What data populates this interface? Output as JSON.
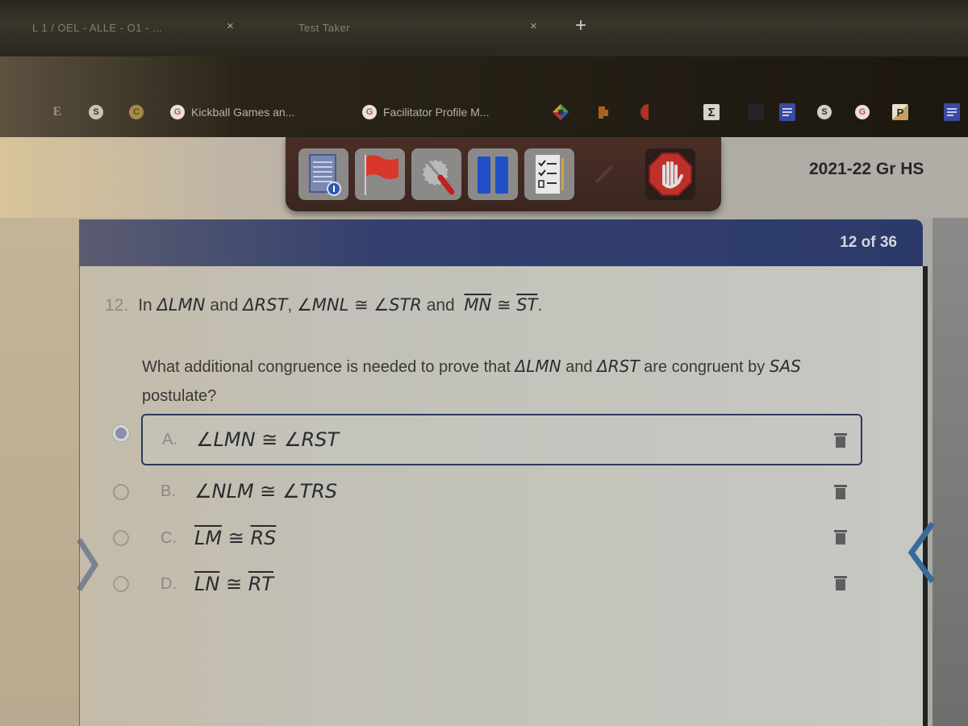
{
  "browser": {
    "tabs": [
      {
        "title": "L 1 / OEL - ALLE - O1 - ...",
        "close": "×"
      },
      {
        "title": "Test Taker",
        "close": "×"
      }
    ],
    "new_tab": "+"
  },
  "bookmarks": [
    {
      "icon": "extension-icon",
      "glyph": "E",
      "label": ""
    },
    {
      "icon": "circle-arrow-icon",
      "glyph": "S",
      "label": ""
    },
    {
      "icon": "c-circle-icon",
      "glyph": "C",
      "label": ""
    },
    {
      "icon": "google-icon",
      "glyph": "G",
      "label": "Kickball Games an..."
    },
    {
      "icon": "google-icon",
      "glyph": "G",
      "label": "Facilitator Profile M..."
    }
  ],
  "extensions": [
    {
      "icon": "color-diamond-icon"
    },
    {
      "icon": "puzzle-icon"
    },
    {
      "icon": "red-half-circle-icon"
    },
    {
      "icon": "sigma-icon",
      "glyph": "Σ"
    },
    {
      "icon": "blue-square-icon"
    },
    {
      "icon": "docs-icon"
    },
    {
      "icon": "circle-arrow-icon",
      "glyph": "S"
    },
    {
      "icon": "google-icon",
      "glyph": "G"
    },
    {
      "icon": "p-icon",
      "glyph": "P"
    },
    {
      "icon": "docs-icon"
    }
  ],
  "toolbar": {
    "buttons": [
      {
        "name": "test-info-button",
        "icon": "document-info-icon"
      },
      {
        "name": "flag-button",
        "icon": "flag-icon"
      },
      {
        "name": "tools-button",
        "icon": "gear-screwdriver-icon"
      },
      {
        "name": "pause-button",
        "icon": "pause-icon"
      },
      {
        "name": "review-button",
        "icon": "checklist-icon"
      },
      {
        "name": "disabled-button",
        "icon": "dim-icon"
      },
      {
        "name": "stop-button",
        "icon": "stop-hand-icon"
      }
    ]
  },
  "course_title": "2021-22 Gr HS",
  "progress": {
    "current": 12,
    "total": 36,
    "label": "12 of 36"
  },
  "question": {
    "number": "12.",
    "stem": {
      "p1": "In ",
      "t1": "ΔLMN",
      "p2": " and ",
      "t2": "ΔRST",
      "p3": ", ",
      "a1": "∠MNL ≅ ∠STR",
      "p4": " and ",
      "s1": "MN",
      "cong": " ≅ ",
      "s2": "ST",
      "p5": "."
    },
    "prompt": {
      "p1": "What additional congruence is needed to prove that ",
      "t1": "ΔLMN",
      "p2": " and ",
      "t2": "ΔRST",
      "p3": " are congruent by ",
      "sas": "SAS",
      "p4": " postulate?"
    },
    "choices": [
      {
        "letter": "A.",
        "left": "∠LMN",
        "cong": " ≅ ",
        "right": "∠RST",
        "segment": false,
        "selected": true
      },
      {
        "letter": "B.",
        "left": "∠NLM",
        "cong": " ≅ ",
        "right": "∠TRS",
        "segment": false,
        "selected": false
      },
      {
        "letter": "C.",
        "left": "LM",
        "cong": " ≅ ",
        "right": "RS",
        "segment": true,
        "selected": false
      },
      {
        "letter": "D.",
        "left": "LN",
        "cong": " ≅ ",
        "right": "RT",
        "segment": true,
        "selected": false
      }
    ],
    "selected_choice": "A"
  },
  "colors": {
    "header_blue": "#2c3a6a",
    "selection_border": "#2e3a58",
    "nav_arrow": "#3a6a9a",
    "stop_red": "#c0302a",
    "flag_red": "#d8382a",
    "pause_blue": "#2050c8"
  }
}
